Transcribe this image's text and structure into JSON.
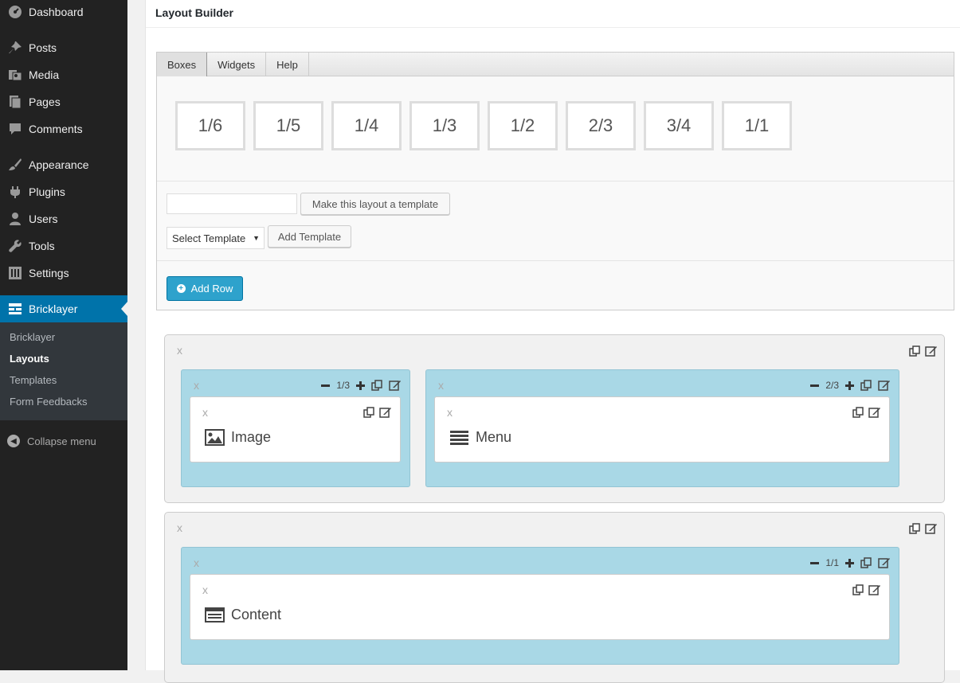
{
  "sidebar": {
    "items": [
      {
        "label": "Dashboard",
        "icon": "dashboard-icon"
      },
      {
        "label": "Posts",
        "icon": "pin-icon"
      },
      {
        "label": "Media",
        "icon": "media-icon"
      },
      {
        "label": "Pages",
        "icon": "pages-icon"
      },
      {
        "label": "Comments",
        "icon": "comment-icon"
      },
      {
        "label": "Appearance",
        "icon": "brush-icon"
      },
      {
        "label": "Plugins",
        "icon": "plugin-icon"
      },
      {
        "label": "Users",
        "icon": "user-icon"
      },
      {
        "label": "Tools",
        "icon": "wrench-icon"
      },
      {
        "label": "Settings",
        "icon": "settings-icon"
      },
      {
        "label": "Bricklayer",
        "icon": "bricklayer-icon"
      }
    ],
    "submenu": [
      "Bricklayer",
      "Layouts",
      "Templates",
      "Form Feedbacks"
    ],
    "collapse_label": "Collapse menu"
  },
  "main": {
    "title": "Layout Builder",
    "tabs": [
      "Boxes",
      "Widgets",
      "Help"
    ],
    "sizes": [
      "1/6",
      "1/5",
      "1/4",
      "1/3",
      "1/2",
      "2/3",
      "3/4",
      "1/1"
    ],
    "make_template_label": "Make this layout a template",
    "select_template_value": "Select Template",
    "add_template_label": "Add Template",
    "add_row_label": "Add Row"
  },
  "rows": [
    {
      "x": "x",
      "columns": [
        {
          "x": "x",
          "size": "1/3",
          "widget": {
            "x": "x",
            "label": "Image",
            "icon": "image-icon"
          }
        },
        {
          "x": "x",
          "size": "2/3",
          "widget": {
            "x": "x",
            "label": "Menu",
            "icon": "menu-icon"
          }
        }
      ]
    },
    {
      "x": "x",
      "columns": [
        {
          "x": "x",
          "size": "1/1",
          "widget": {
            "x": "x",
            "label": "Content",
            "icon": "content-icon"
          }
        }
      ]
    }
  ],
  "colors": {
    "sidebar_bg": "#222222",
    "active_menu": "#0073aa",
    "add_row_button": "#2ea2cc",
    "column_bg": "#a9d8e6"
  }
}
